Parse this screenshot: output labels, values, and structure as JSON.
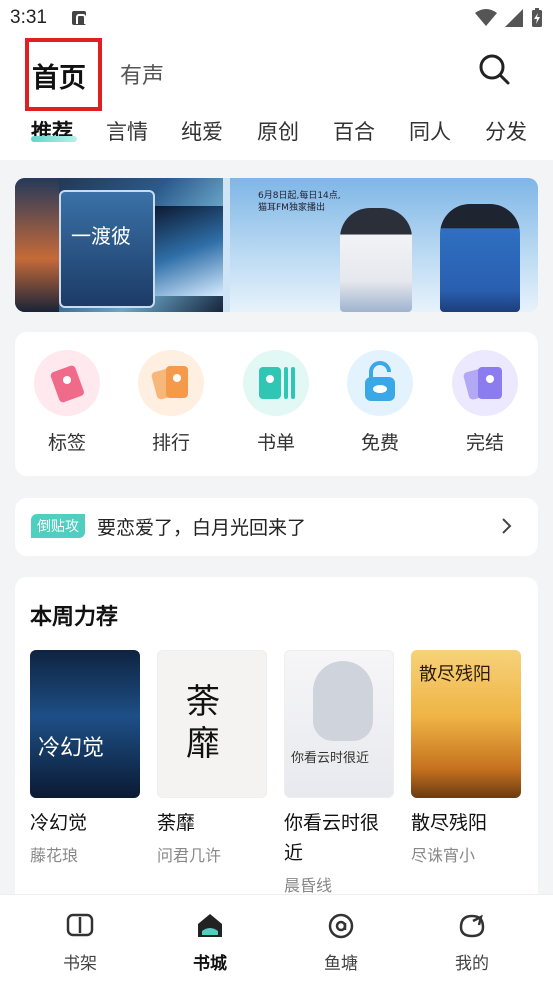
{
  "status_bar": {
    "time": "3:31"
  },
  "header": {
    "tabs": [
      {
        "label": "首页",
        "active": true
      },
      {
        "label": "有声",
        "active": false
      }
    ],
    "categories": [
      "推荐",
      "言情",
      "纯爱",
      "原创",
      "百合",
      "同人",
      "分发"
    ],
    "active_category": "推荐"
  },
  "banner": {
    "left_title": "一渡彼",
    "right_note": "6月8日起,每日14点,猫耳FM独家播出"
  },
  "quick_menu": [
    {
      "label": "标签",
      "icon": "tag-icon",
      "color": "#f06a8a",
      "bg": "#ffe9ee"
    },
    {
      "label": "排行",
      "icon": "ranking-icon",
      "color": "#f49a4a",
      "bg": "#ffefe1"
    },
    {
      "label": "书单",
      "icon": "booklist-icon",
      "color": "#2fc6b3",
      "bg": "#e1f8f5"
    },
    {
      "label": "免费",
      "icon": "free-icon",
      "color": "#3aa7e6",
      "bg": "#e2f3fd"
    },
    {
      "label": "完结",
      "icon": "completed-icon",
      "color": "#8b7cf0",
      "bg": "#ece9ff"
    }
  ],
  "promo": {
    "badge": "倒贴攻",
    "text": "要恋爱了，白月光回来了"
  },
  "weekly": {
    "title": "本周力荐",
    "books": [
      {
        "name": "冷幻觉",
        "author": "藤花琅",
        "cover_title": "冷幻觉"
      },
      {
        "name": "荼靡",
        "author": "问君几许",
        "cover_title": "荼靡"
      },
      {
        "name": "你看云时很近",
        "author": "晨昏线",
        "cover_title": "你看云时很近"
      },
      {
        "name": "散尽残阳",
        "author": "尽诛宵小",
        "cover_title": "散尽残阳"
      }
    ]
  },
  "bottom_nav": [
    {
      "label": "书架",
      "icon": "bookshelf-icon",
      "active": false
    },
    {
      "label": "书城",
      "icon": "bookstore-icon",
      "active": true
    },
    {
      "label": "鱼塘",
      "icon": "fishpond-icon",
      "active": false
    },
    {
      "label": "我的",
      "icon": "profile-icon",
      "active": false
    }
  ],
  "colors": {
    "accent": "#4ecfc0",
    "highlight_box": "#e02020"
  }
}
